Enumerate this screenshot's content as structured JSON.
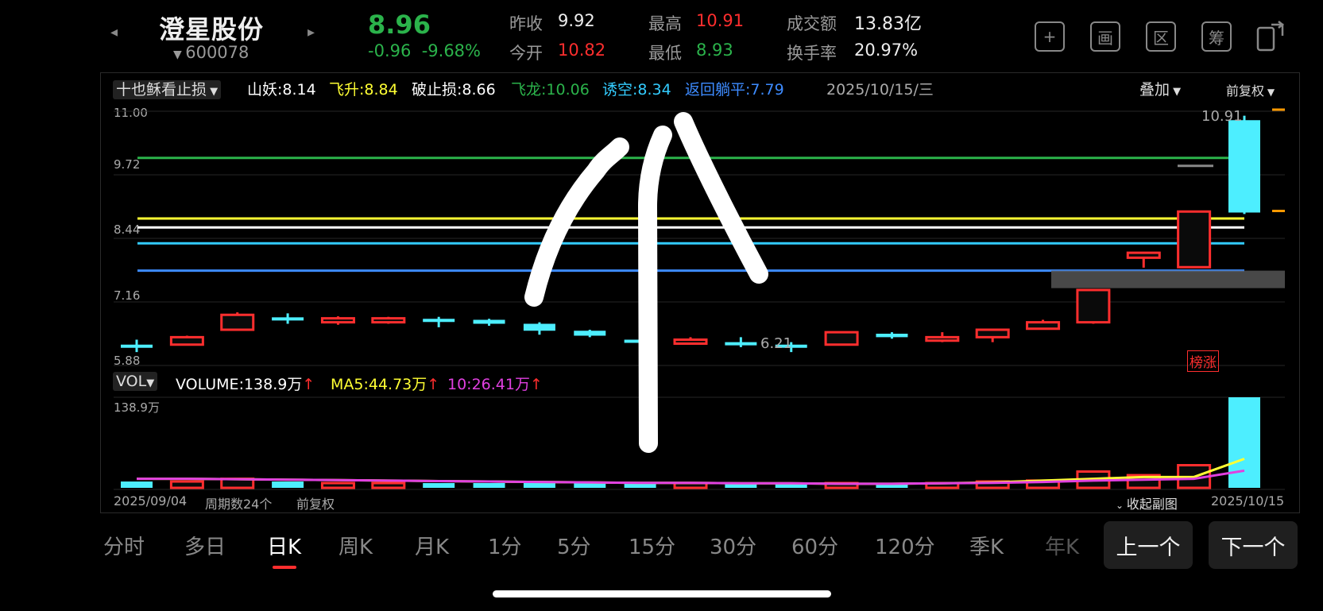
{
  "header": {
    "name": "澄星股份",
    "code": "600078",
    "price": "8.96",
    "change": "-0.96",
    "change_pct": "-9.68%",
    "stats": {
      "prev_close_label": "昨收",
      "prev_close": "9.92",
      "open_label": "今开",
      "open": "10.82",
      "high_label": "最高",
      "high": "10.91",
      "low_label": "最低",
      "low": "8.93",
      "turnover_label": "成交额",
      "turnover": "13.83亿",
      "turnover_rate_label": "换手率",
      "turnover_rate": "20.97%"
    },
    "tools": [
      "+",
      "画",
      "区",
      "筹"
    ]
  },
  "indicator": {
    "selector": "十也稣看止损",
    "items": [
      {
        "label": "山妖:8.14",
        "color": "#ffffff"
      },
      {
        "label": "飞升:8.84",
        "color": "#ffff33"
      },
      {
        "label": "破止损:8.66",
        "color": "#ffffff"
      },
      {
        "label": "飞龙:10.06",
        "color": "#2bb34b"
      },
      {
        "label": "诱空:8.34",
        "color": "#33ccff"
      },
      {
        "label": "返回躺平:7.79",
        "color": "#3d8bff"
      }
    ],
    "date": "2025/10/15/三",
    "overlay": "叠加",
    "adjust": "前复权"
  },
  "price_axis": [
    "11.00",
    "9.72",
    "8.44",
    "7.16",
    "5.88"
  ],
  "annotations": {
    "high_label": "10.91",
    "low_label": "6.21",
    "rank_badge": "榜涨"
  },
  "volume": {
    "selector": "VOL",
    "vol_label": "VOLUME:138.9万",
    "ma5_label": "MA5:44.73万",
    "ma10_label": "10:26.41万",
    "axis_top": "138.9万"
  },
  "footer": {
    "start_date": "2025/09/04",
    "period": "周期数24个",
    "adjust": "前复权",
    "collapse": "收起副图",
    "end_date": "2025/10/15"
  },
  "tabs": [
    "分时",
    "多日",
    "日K",
    "周K",
    "月K",
    "1分",
    "5分",
    "15分",
    "30分",
    "60分",
    "120分",
    "季K",
    "年K"
  ],
  "active_tab": "日K",
  "nav": {
    "prev": "上一个",
    "next": "下一个"
  },
  "colors": {
    "up": "#ff2e2e",
    "down": "#4deeff",
    "green": "#2bb34b"
  },
  "chart_data": {
    "type": "candlestick",
    "ylim": [
      5.88,
      11.0
    ],
    "candles": [
      {
        "o": 6.3,
        "c": 6.3,
        "h": 6.4,
        "l": 6.15,
        "dir": "down"
      },
      {
        "o": 6.3,
        "c": 6.45,
        "h": 6.48,
        "l": 6.28,
        "dir": "up"
      },
      {
        "o": 6.6,
        "c": 6.9,
        "h": 6.95,
        "l": 6.58,
        "dir": "up"
      },
      {
        "o": 6.85,
        "c": 6.85,
        "h": 6.93,
        "l": 6.72,
        "dir": "down"
      },
      {
        "o": 6.75,
        "c": 6.83,
        "h": 6.87,
        "l": 6.7,
        "dir": "up"
      },
      {
        "o": 6.75,
        "c": 6.83,
        "h": 6.86,
        "l": 6.72,
        "dir": "up"
      },
      {
        "o": 6.82,
        "c": 6.82,
        "h": 6.86,
        "l": 6.65,
        "dir": "down"
      },
      {
        "o": 6.8,
        "c": 6.72,
        "h": 6.82,
        "l": 6.68,
        "dir": "down"
      },
      {
        "o": 6.72,
        "c": 6.58,
        "h": 6.75,
        "l": 6.5,
        "dir": "down"
      },
      {
        "o": 6.58,
        "c": 6.48,
        "h": 6.6,
        "l": 6.45,
        "dir": "down"
      },
      {
        "o": 6.4,
        "c": 6.35,
        "h": 6.45,
        "l": 6.25,
        "dir": "down"
      },
      {
        "o": 6.32,
        "c": 6.4,
        "h": 6.45,
        "l": 6.3,
        "dir": "up"
      },
      {
        "o": 6.35,
        "c": 6.35,
        "h": 6.45,
        "l": 6.25,
        "dir": "down"
      },
      {
        "o": 6.3,
        "c": 6.3,
        "h": 6.35,
        "l": 6.15,
        "dir": "down"
      },
      {
        "o": 6.3,
        "c": 6.55,
        "h": 6.55,
        "l": 6.28,
        "dir": "up"
      },
      {
        "o": 6.52,
        "c": 6.45,
        "h": 6.55,
        "l": 6.42,
        "dir": "down"
      },
      {
        "o": 6.38,
        "c": 6.45,
        "h": 6.55,
        "l": 6.35,
        "dir": "up"
      },
      {
        "o": 6.45,
        "c": 6.6,
        "h": 6.62,
        "l": 6.35,
        "dir": "up"
      },
      {
        "o": 6.62,
        "c": 6.75,
        "h": 6.8,
        "l": 6.6,
        "dir": "up"
      },
      {
        "o": 6.75,
        "c": 7.4,
        "h": 7.4,
        "l": 6.72,
        "dir": "up"
      },
      {
        "o": 8.05,
        "c": 8.15,
        "h": 8.15,
        "l": 7.85,
        "dir": "up"
      },
      {
        "o": 7.86,
        "c": 8.98,
        "h": 8.98,
        "l": 7.86,
        "dir": "up"
      },
      {
        "o": 10.82,
        "c": 8.96,
        "h": 10.91,
        "l": 8.93,
        "dir": "down"
      }
    ],
    "levels": [
      {
        "value": 10.06,
        "color": "#2bb34b"
      },
      {
        "value": 8.84,
        "color": "#ffff33"
      },
      {
        "value": 8.66,
        "color": "#ffffff"
      },
      {
        "value": 8.34,
        "color": "#33ccff"
      },
      {
        "value": 7.79,
        "color": "#3d8bff"
      }
    ],
    "volumes": [
      0.07,
      0.07,
      0.1,
      0.07,
      0.05,
      0.05,
      0.05,
      0.05,
      0.04,
      0.04,
      0.04,
      0.05,
      0.04,
      0.04,
      0.04,
      0.04,
      0.05,
      0.07,
      0.08,
      0.18,
      0.14,
      0.25,
      1.0
    ],
    "ma5": [
      0.1,
      0.1,
      0.095,
      0.09,
      0.085,
      0.08,
      0.075,
      0.07,
      0.065,
      0.06,
      0.055,
      0.055,
      0.05,
      0.05,
      0.045,
      0.045,
      0.05,
      0.06,
      0.08,
      0.1,
      0.12,
      0.12,
      0.32
    ],
    "ma10": [
      0.1,
      0.1,
      0.095,
      0.09,
      0.085,
      0.08,
      0.075,
      0.07,
      0.065,
      0.06,
      0.055,
      0.055,
      0.05,
      0.05,
      0.045,
      0.045,
      0.05,
      0.055,
      0.065,
      0.08,
      0.09,
      0.1,
      0.19
    ]
  }
}
